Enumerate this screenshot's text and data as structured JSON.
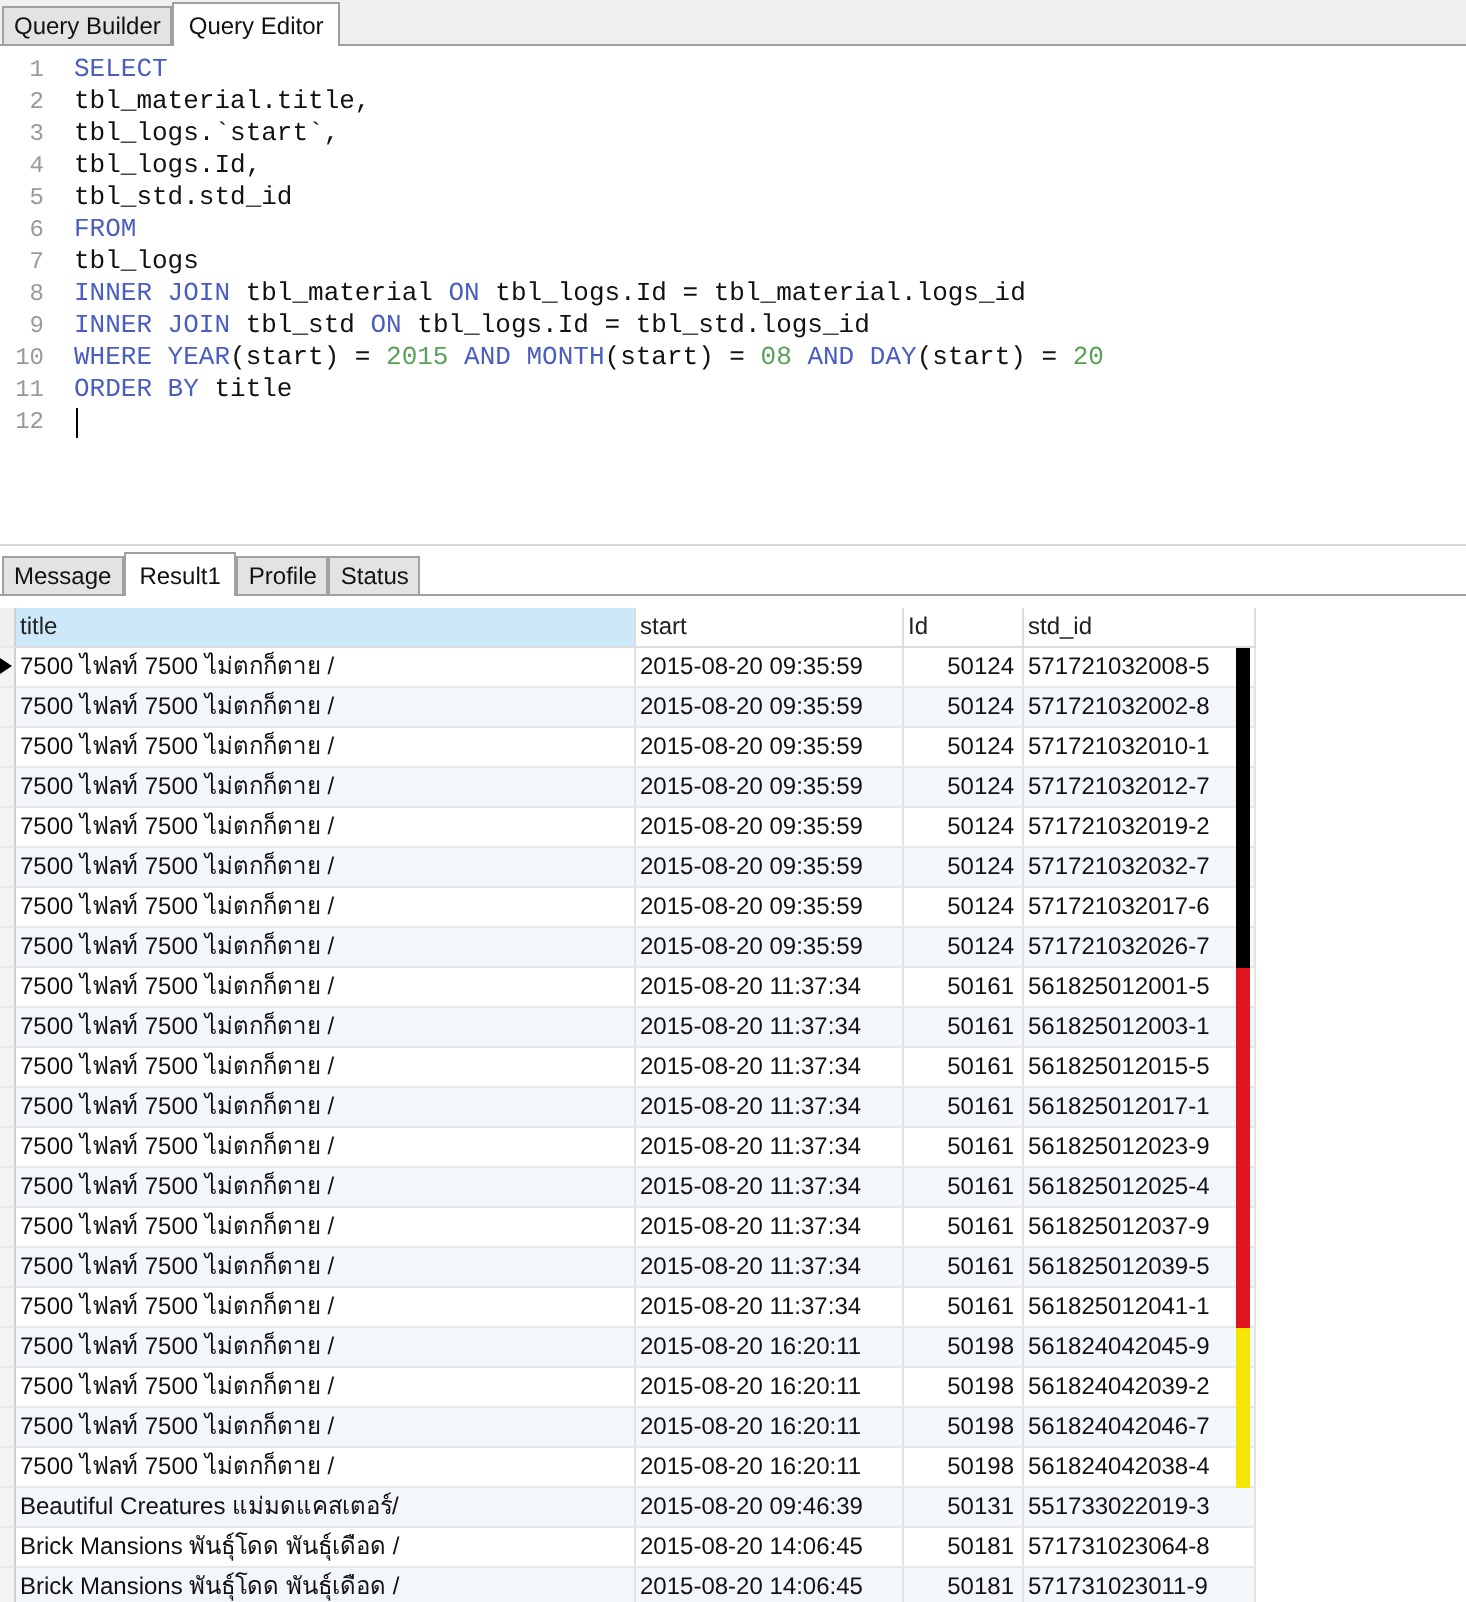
{
  "editor_tabs": [
    {
      "label": "Query Builder",
      "selected": false
    },
    {
      "label": "Query Editor",
      "selected": true
    }
  ],
  "editor": {
    "lines": [
      {
        "number": "1",
        "cursor": false,
        "tokens": [
          {
            "kind": "keyword",
            "text": "SELECT"
          }
        ]
      },
      {
        "number": "2",
        "cursor": false,
        "tokens": [
          {
            "kind": "plain",
            "text": "tbl_material.title,"
          }
        ]
      },
      {
        "number": "3",
        "cursor": false,
        "tokens": [
          {
            "kind": "plain",
            "text": "tbl_logs.`start`,"
          }
        ]
      },
      {
        "number": "4",
        "cursor": false,
        "tokens": [
          {
            "kind": "plain",
            "text": "tbl_logs.Id,"
          }
        ]
      },
      {
        "number": "5",
        "cursor": false,
        "tokens": [
          {
            "kind": "plain",
            "text": "tbl_std.std_id"
          }
        ]
      },
      {
        "number": "6",
        "cursor": false,
        "tokens": [
          {
            "kind": "keyword",
            "text": "FROM"
          }
        ]
      },
      {
        "number": "7",
        "cursor": false,
        "tokens": [
          {
            "kind": "plain",
            "text": "tbl_logs"
          }
        ]
      },
      {
        "number": "8",
        "cursor": false,
        "tokens": [
          {
            "kind": "keyword",
            "text": "INNER JOIN"
          },
          {
            "kind": "plain",
            "text": " tbl_material "
          },
          {
            "kind": "keyword",
            "text": "ON"
          },
          {
            "kind": "plain",
            "text": " tbl_logs.Id = tbl_material.logs_id"
          }
        ]
      },
      {
        "number": "9",
        "cursor": false,
        "tokens": [
          {
            "kind": "keyword",
            "text": "INNER JOIN"
          },
          {
            "kind": "plain",
            "text": " tbl_std "
          },
          {
            "kind": "keyword",
            "text": "ON"
          },
          {
            "kind": "plain",
            "text": " tbl_logs.Id = tbl_std.logs_id"
          }
        ]
      },
      {
        "number": "10",
        "cursor": false,
        "tokens": [
          {
            "kind": "keyword",
            "text": "WHERE YEAR"
          },
          {
            "kind": "plain",
            "text": "(start) = "
          },
          {
            "kind": "number",
            "text": "2015"
          },
          {
            "kind": "keyword",
            "text": " AND MONTH"
          },
          {
            "kind": "plain",
            "text": "(start) = "
          },
          {
            "kind": "number",
            "text": "08"
          },
          {
            "kind": "keyword",
            "text": " AND DAY"
          },
          {
            "kind": "plain",
            "text": "(start) = "
          },
          {
            "kind": "number",
            "text": "20"
          }
        ]
      },
      {
        "number": "11",
        "cursor": false,
        "tokens": [
          {
            "kind": "keyword",
            "text": "ORDER BY"
          },
          {
            "kind": "plain",
            "text": " title"
          }
        ]
      },
      {
        "number": "12",
        "cursor": true
      }
    ]
  },
  "result_tabs": [
    {
      "label": "Message",
      "selected": false
    },
    {
      "label": "Result1",
      "selected": true
    },
    {
      "label": "Profile",
      "selected": false
    },
    {
      "label": "Status",
      "selected": false
    }
  ],
  "table": {
    "columns": [
      {
        "label": "title",
        "selected": true
      },
      {
        "label": "start",
        "selected": false
      },
      {
        "label": "Id",
        "selected": false
      },
      {
        "label": "std_id",
        "selected": false
      }
    ],
    "rows": [
      {
        "selected": true,
        "color": "#000000",
        "cells": [
          "7500 ไฟลท์ 7500 ไม่ตกก็ตาย /",
          "2015-08-20 09:35:59",
          "50124",
          "571721032008-5"
        ]
      },
      {
        "selected": false,
        "color": "#000000",
        "cells": [
          "7500 ไฟลท์ 7500 ไม่ตกก็ตาย /",
          "2015-08-20 09:35:59",
          "50124",
          "571721032002-8"
        ]
      },
      {
        "selected": false,
        "color": "#000000",
        "cells": [
          "7500 ไฟลท์ 7500 ไม่ตกก็ตาย /",
          "2015-08-20 09:35:59",
          "50124",
          "571721032010-1"
        ]
      },
      {
        "selected": false,
        "color": "#000000",
        "cells": [
          "7500 ไฟลท์ 7500 ไม่ตกก็ตาย /",
          "2015-08-20 09:35:59",
          "50124",
          "571721032012-7"
        ]
      },
      {
        "selected": false,
        "color": "#000000",
        "cells": [
          "7500 ไฟลท์ 7500 ไม่ตกก็ตาย /",
          "2015-08-20 09:35:59",
          "50124",
          "571721032019-2"
        ]
      },
      {
        "selected": false,
        "color": "#000000",
        "cells": [
          "7500 ไฟลท์ 7500 ไม่ตกก็ตาย /",
          "2015-08-20 09:35:59",
          "50124",
          "571721032032-7"
        ]
      },
      {
        "selected": false,
        "color": "#000000",
        "cells": [
          "7500 ไฟลท์ 7500 ไม่ตกก็ตาย /",
          "2015-08-20 09:35:59",
          "50124",
          "571721032017-6"
        ]
      },
      {
        "selected": false,
        "color": "#000000",
        "cells": [
          "7500 ไฟลท์ 7500 ไม่ตกก็ตาย /",
          "2015-08-20 09:35:59",
          "50124",
          "571721032026-7"
        ]
      },
      {
        "selected": false,
        "color": "#e0141e",
        "cells": [
          "7500 ไฟลท์ 7500 ไม่ตกก็ตาย /",
          "2015-08-20 11:37:34",
          "50161",
          "561825012001-5"
        ]
      },
      {
        "selected": false,
        "color": "#e0141e",
        "cells": [
          "7500 ไฟลท์ 7500 ไม่ตกก็ตาย /",
          "2015-08-20 11:37:34",
          "50161",
          "561825012003-1"
        ]
      },
      {
        "selected": false,
        "color": "#e0141e",
        "cells": [
          "7500 ไฟลท์ 7500 ไม่ตกก็ตาย /",
          "2015-08-20 11:37:34",
          "50161",
          "561825012015-5"
        ]
      },
      {
        "selected": false,
        "color": "#e0141e",
        "cells": [
          "7500 ไฟลท์ 7500 ไม่ตกก็ตาย /",
          "2015-08-20 11:37:34",
          "50161",
          "561825012017-1"
        ]
      },
      {
        "selected": false,
        "color": "#e0141e",
        "cells": [
          "7500 ไฟลท์ 7500 ไม่ตกก็ตาย /",
          "2015-08-20 11:37:34",
          "50161",
          "561825012023-9"
        ]
      },
      {
        "selected": false,
        "color": "#e0141e",
        "cells": [
          "7500 ไฟลท์ 7500 ไม่ตกก็ตาย /",
          "2015-08-20 11:37:34",
          "50161",
          "561825012025-4"
        ]
      },
      {
        "selected": false,
        "color": "#e0141e",
        "cells": [
          "7500 ไฟลท์ 7500 ไม่ตกก็ตาย /",
          "2015-08-20 11:37:34",
          "50161",
          "561825012037-9"
        ]
      },
      {
        "selected": false,
        "color": "#e0141e",
        "cells": [
          "7500 ไฟลท์ 7500 ไม่ตกก็ตาย /",
          "2015-08-20 11:37:34",
          "50161",
          "561825012039-5"
        ]
      },
      {
        "selected": false,
        "color": "#e0141e",
        "cells": [
          "7500 ไฟลท์ 7500 ไม่ตกก็ตาย /",
          "2015-08-20 11:37:34",
          "50161",
          "561825012041-1"
        ]
      },
      {
        "selected": false,
        "color": "#f5e600",
        "cells": [
          "7500 ไฟลท์ 7500 ไม่ตกก็ตาย /",
          "2015-08-20 16:20:11",
          "50198",
          "561824042045-9"
        ]
      },
      {
        "selected": false,
        "color": "#f5e600",
        "cells": [
          "7500 ไฟลท์ 7500 ไม่ตกก็ตาย /",
          "2015-08-20 16:20:11",
          "50198",
          "561824042039-2"
        ]
      },
      {
        "selected": false,
        "color": "#f5e600",
        "cells": [
          "7500 ไฟลท์ 7500 ไม่ตกก็ตาย /",
          "2015-08-20 16:20:11",
          "50198",
          "561824042046-7"
        ]
      },
      {
        "selected": false,
        "color": "#f5e600",
        "cells": [
          "7500 ไฟลท์ 7500 ไม่ตกก็ตาย /",
          "2015-08-20 16:20:11",
          "50198",
          "561824042038-4"
        ]
      },
      {
        "selected": false,
        "cells": [
          "Beautiful Creatures แม่มดแคสเตอร์/",
          "2015-08-20 09:46:39",
          "50131",
          "551733022019-3"
        ]
      },
      {
        "selected": false,
        "cells": [
          "Brick Mansions พันธุ์โดด พันธุ์เดือด /",
          "2015-08-20 14:06:45",
          "50181",
          "571731023064-8"
        ]
      },
      {
        "selected": false,
        "cells": [
          "Brick Mansions พันธุ์โดด พันธุ์เดือด /",
          "2015-08-20 14:06:45",
          "50181",
          "571731023011-9"
        ]
      }
    ]
  }
}
